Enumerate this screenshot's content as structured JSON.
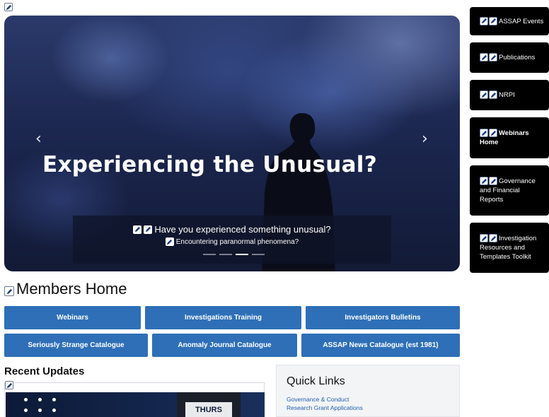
{
  "carousel": {
    "headline": "Experiencing the Unusual?",
    "caption_title": "Have you experienced something unusual?",
    "caption_subtitle": "Encountering paranormal phenomena?",
    "prev_arrow": "‹",
    "next_arrow": "›",
    "slide_count": 4,
    "active_slide": 3
  },
  "sidebar": {
    "items": [
      {
        "label": "ASSAP Events"
      },
      {
        "label": "Publications"
      },
      {
        "label": "NRPI"
      },
      {
        "label": "Webinars Home"
      },
      {
        "label": "Governance and Financial Reports"
      },
      {
        "label": "Investigation Resources and Templates Toolkit"
      }
    ]
  },
  "members": {
    "title": "Members Home",
    "row1": [
      {
        "label": "Webinars"
      },
      {
        "label": "Investigations Training"
      },
      {
        "label": "Investigators Bulletins"
      }
    ],
    "row2": [
      {
        "label": "Seriously Strange Catalogue"
      },
      {
        "label": "Anomaly Journal Catalogue"
      },
      {
        "label": "ASSAP News Catalogue (est 1981)"
      }
    ]
  },
  "recent": {
    "title": "Recent Updates",
    "thumb_text": "THURS"
  },
  "quick_links": {
    "title": "Quick Links",
    "links": [
      {
        "label": "Governance & Conduct"
      },
      {
        "label": "Research Grant Applications"
      }
    ]
  },
  "colors": {
    "button_blue": "#2e6fb8",
    "sidebar_bg": "#000000",
    "link_blue": "#1f5fb0"
  },
  "icons": {
    "edit": "pencil-edit-icon"
  }
}
